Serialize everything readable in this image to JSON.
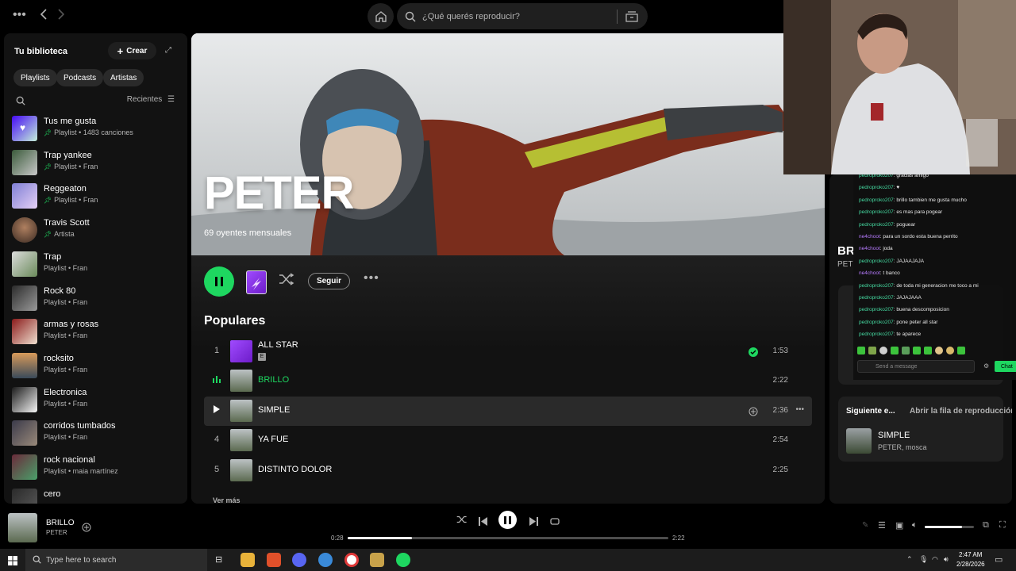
{
  "topbar": {
    "search_placeholder": "¿Qué querés reproducir?"
  },
  "library": {
    "title": "Tu biblioteca",
    "create_label": "Crear",
    "filters": [
      "Playlists",
      "Podcasts",
      "Artistas"
    ],
    "sort_label": "Recientes",
    "items": [
      {
        "name": "Tus me gusta",
        "sub": "Playlist • 1483 canciones",
        "pinned": true
      },
      {
        "name": "Trap yankee",
        "sub": "Playlist • Fran",
        "pinned": true
      },
      {
        "name": "Reggeaton",
        "sub": "Playlist • Fran",
        "pinned": true
      },
      {
        "name": "Travis Scott",
        "sub": "Artista",
        "pinned": true
      },
      {
        "name": "Trap",
        "sub": "Playlist • Fran",
        "pinned": false
      },
      {
        "name": "Rock 80",
        "sub": "Playlist • Fran",
        "pinned": false
      },
      {
        "name": "armas y rosas",
        "sub": "Playlist • Fran",
        "pinned": false
      },
      {
        "name": "rocksito",
        "sub": "Playlist • Fran",
        "pinned": false
      },
      {
        "name": "Electronica",
        "sub": "Playlist • Fran",
        "pinned": false
      },
      {
        "name": "corridos tumbados",
        "sub": "Playlist • Fran",
        "pinned": false
      },
      {
        "name": "rock nacional",
        "sub": "Playlist • maia martínez",
        "pinned": false
      },
      {
        "name": "cero",
        "sub": "",
        "pinned": false
      }
    ]
  },
  "artist": {
    "name": "PETER",
    "listeners": "69 oyentes mensuales",
    "follow_label": "Seguir",
    "popular_title": "Populares",
    "see_more": "Ver más",
    "tracks": [
      {
        "num": "1",
        "title": "ALL STAR",
        "explicit": "E",
        "duration": "1:53",
        "saved": true
      },
      {
        "num": "",
        "title": "BRILLO",
        "duration": "2:22",
        "playing": true
      },
      {
        "num": "",
        "title": "SIMPLE",
        "duration": "2:36",
        "hover": true
      },
      {
        "num": "4",
        "title": "YA FUE",
        "duration": "2:54"
      },
      {
        "num": "5",
        "title": "DISTINTO DOLOR",
        "duration": "2:25"
      }
    ]
  },
  "right_panel": {
    "artist_short": "BR",
    "artist_sub": "PET",
    "next_label": "Siguiente e...",
    "open_queue": "Abrir la fila de reproducción",
    "next_title": "SIMPLE",
    "next_artist": "PETER, mosca"
  },
  "chat": {
    "lines": [
      {
        "user": "pedroproko207",
        "msg": ": gracias amigo"
      },
      {
        "user": "pedroproko207",
        "msg": ": ♥"
      },
      {
        "user": "pedroproko207",
        "msg": ": brillo tambien me gusta mucho"
      },
      {
        "user": "pedroproko207",
        "msg": ": es mas para pogear"
      },
      {
        "user": "pedroproko207",
        "msg": ": poguear"
      },
      {
        "user": "ne4choot",
        "msg": ": para un sordo esta buena perrito"
      },
      {
        "user": "ne4choot",
        "msg": ": joda"
      },
      {
        "user": "pedroproko207",
        "msg": ": JAJAAJAJA"
      },
      {
        "user": "ne4choot",
        "msg": ": t banco"
      },
      {
        "user": "pedroproko207",
        "msg": ": de toda mi generacion me toco a mi"
      },
      {
        "user": "pedroproko207",
        "msg": ": JAJAJAAA"
      },
      {
        "user": "pedroproko207",
        "msg": ": buena descomposicion"
      },
      {
        "user": "pedroproko207",
        "msg": ": pone peter all star"
      },
      {
        "user": "pedroproko207",
        "msg": ": te aparece"
      }
    ],
    "input_placeholder": "Send a message",
    "chat_button": "Chat"
  },
  "player": {
    "title": "BRILLO",
    "artist": "PETER",
    "time_current": "0:28",
    "time_total": "2:22",
    "progress": 0.2,
    "volume": 0.75
  },
  "taskbar": {
    "search_placeholder": "Type here to search",
    "time": "2:47 AM",
    "date": "2/28/2026"
  },
  "colors": {
    "accent": "#1ed760",
    "background": "#121212"
  }
}
